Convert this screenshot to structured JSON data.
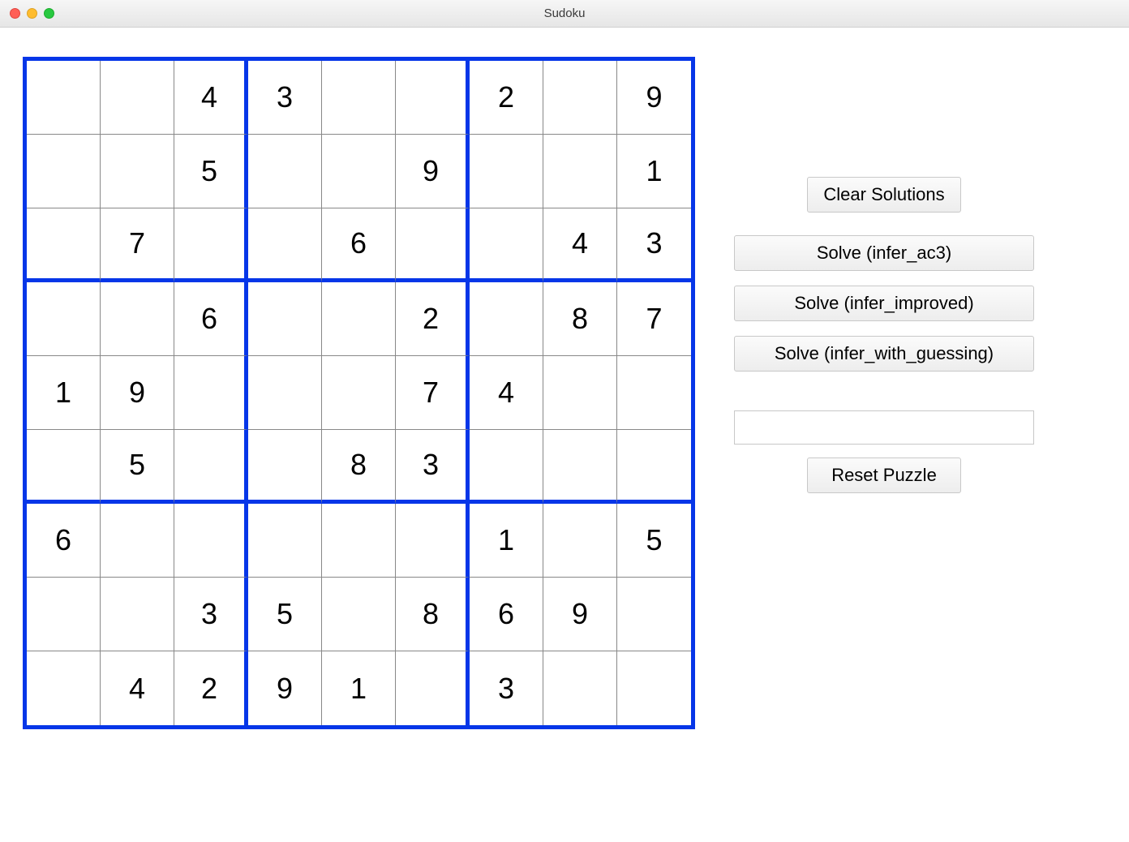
{
  "window": {
    "title": "Sudoku"
  },
  "grid": [
    [
      "",
      "",
      "4",
      "3",
      "",
      "",
      "2",
      "",
      "9"
    ],
    [
      "",
      "",
      "5",
      "",
      "",
      "9",
      "",
      "",
      "1"
    ],
    [
      "",
      "7",
      "",
      "",
      "6",
      "",
      "",
      "4",
      "3"
    ],
    [
      "",
      "",
      "6",
      "",
      "",
      "2",
      "",
      "8",
      "7"
    ],
    [
      "1",
      "9",
      "",
      "",
      "",
      "7",
      "4",
      "",
      ""
    ],
    [
      "",
      "5",
      "",
      "",
      "8",
      "3",
      "",
      "",
      ""
    ],
    [
      "6",
      "",
      "",
      "",
      "",
      "",
      "1",
      "",
      "5"
    ],
    [
      "",
      "",
      "3",
      "5",
      "",
      "8",
      "6",
      "9",
      ""
    ],
    [
      "",
      "4",
      "2",
      "9",
      "1",
      "",
      "3",
      "",
      ""
    ]
  ],
  "buttons": {
    "clear": "Clear Solutions",
    "solve_ac3": "Solve (infer_ac3)",
    "solve_improved": "Solve (infer_improved)",
    "solve_guessing": "Solve (infer_with_guessing)",
    "reset": "Reset Puzzle"
  },
  "input": {
    "value": ""
  }
}
